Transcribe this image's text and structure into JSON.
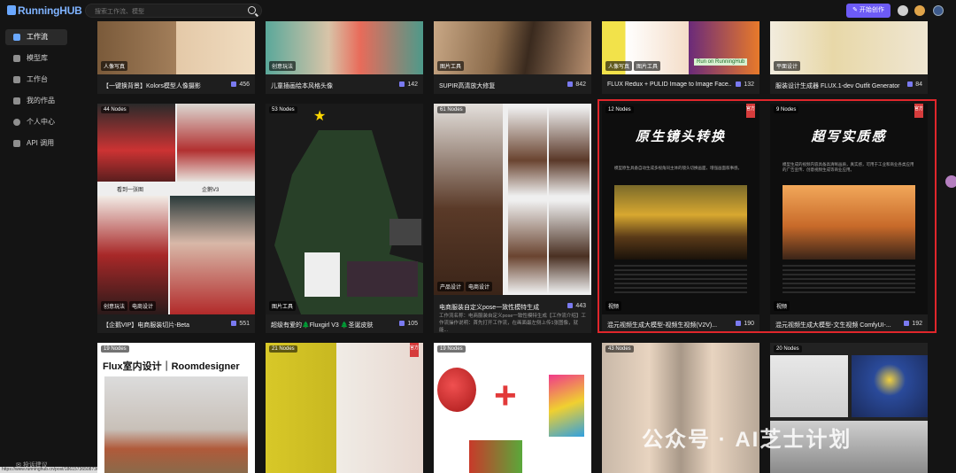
{
  "header": {
    "logo": "RunningHUB",
    "search_placeholder": "搜索工作流、模型",
    "start_button": "开始创作"
  },
  "sidebar": {
    "items": [
      {
        "label": "工作流",
        "active": true
      },
      {
        "label": "模型库",
        "active": false
      },
      {
        "label": "工作台",
        "active": false
      },
      {
        "label": "我的作品",
        "active": false
      },
      {
        "label": "个人中心",
        "active": false
      },
      {
        "label": "API 调用",
        "active": false
      }
    ],
    "feedback": "投诉建议",
    "status_url": "https://www.runninghub.cn/post/1861573650873638"
  },
  "row1": [
    {
      "title": "【一键换背景】Kolors模型人像摄影",
      "count": "456",
      "tags": [
        "人像写真"
      ]
    },
    {
      "title": "儿童插画绘本风格头像",
      "count": "142",
      "tags": [
        "创意玩法"
      ]
    },
    {
      "title": "SUPIR高清放大修复",
      "count": "842",
      "tags": [
        "图片工具"
      ]
    },
    {
      "title": "FLUX Redux + PULID Image to Image Face...",
      "count": "132",
      "tags": [
        "人像写真",
        "图片工具"
      ],
      "badge": "Run on RunningHub"
    },
    {
      "title": "服装设计生成器 FLUX.1-dev Outfit Generator",
      "count": "84",
      "tags": [
        "平面设计"
      ]
    }
  ],
  "row2": [
    {
      "nodes": "44 Nodes",
      "title": "【企鹅VIP】电商服装切片-Beta",
      "count": "551",
      "tags": [
        "创意玩法",
        "电商设计"
      ],
      "captions": [
        "看到一张图",
        "企鹅V3"
      ]
    },
    {
      "nodes": "53 Nodes",
      "title": "超级有爱的🌲Fluxgirl V3 🌲圣诞皮肤",
      "count": "105",
      "tags": [
        "图片工具"
      ]
    },
    {
      "nodes": "61 Nodes",
      "title": "电商服装自定义pose一致性模特生成",
      "count": "443",
      "tags": [
        "产品设计",
        "电商设计"
      ],
      "desc": "工作流名称：电商服装自定义pose一致性模特生成【工作流介绍】工作流操作说明：首先打开工作流，在画面最左侧上传1张图像，就能..."
    },
    {
      "nodes": "12 Nodes",
      "title": "混元视频生成大模型-视频生视频(V2V)...",
      "count": "190",
      "tags": [
        "视频"
      ],
      "headline": "原生镜头转换",
      "sub": "模型原生具备自动生成多视角同主体的镜头切换画面，增强画面叙事感。",
      "ribbon": "官方"
    },
    {
      "nodes": "9 Nodes",
      "title": "混元视频生成大模型-文生视频 ComfyUI-...",
      "count": "192",
      "tags": [
        "视频"
      ],
      "headline": "超写实质感",
      "sub": "模型生成的视频内容具备高清晰画质，真实感，可用于工业和商业各类应用的广告宣传、创意视频生成等商业应用。",
      "ribbon": "官方"
    }
  ],
  "row3": [
    {
      "nodes": "19 Nodes",
      "headline": "Flux室内设计｜Roomdesigner"
    },
    {
      "nodes": "21 Nodes",
      "ribbon": "官方"
    },
    {
      "nodes": "19 Nodes"
    },
    {
      "nodes": "43 Nodes"
    },
    {
      "nodes": "20 Nodes"
    }
  ],
  "watermark": "公众号 · AI芝士计划",
  "colors": {
    "accent": "#6d5bf7",
    "highlight": "#e0262b",
    "bg": "#141414"
  }
}
